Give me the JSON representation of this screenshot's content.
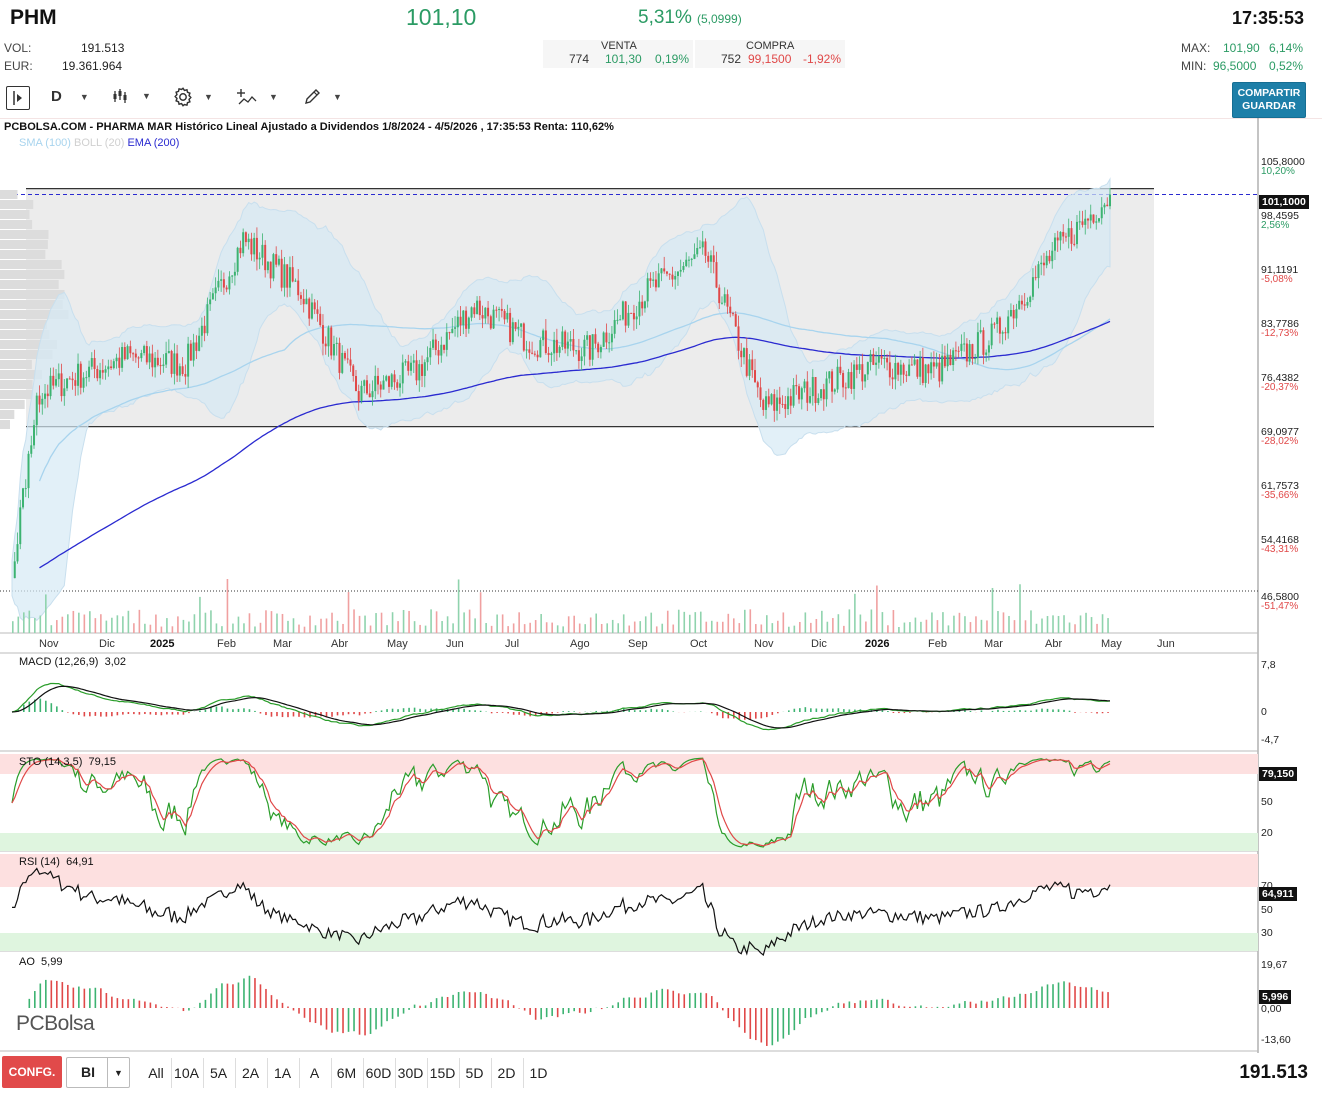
{
  "header": {
    "ticker": "PHM",
    "price": "101,10",
    "change_pct": "5,31%",
    "change_abs": "(5,0999)",
    "time": "17:35:53"
  },
  "stats": {
    "vol_label": "VOL:",
    "vol_value": "191.513",
    "eur_label": "EUR:",
    "eur_value": "19.361.964",
    "max_label": "MAX:",
    "max_value": "101,90",
    "max_pct": "6,14%",
    "min_label": "MIN:",
    "min_value": "96,5000",
    "min_pct": "0,52%"
  },
  "orderbook": {
    "sell_label": "VENTA",
    "sell_qty": "774",
    "sell_price": "101,30",
    "sell_pct": "0,19%",
    "buy_label": "COMPRA",
    "buy_qty": "752",
    "buy_price": "99,1500",
    "buy_pct": "-1,92%"
  },
  "toolbar": {
    "period": "D",
    "share_line1": "COMPARTIR",
    "share_line2": "GUARDAR",
    "icons": [
      "panel-toggle-icon",
      "candles-icon",
      "gear-icon",
      "indicator-icon",
      "pencil-icon"
    ]
  },
  "chart": {
    "title": "PCBOLSA.COM - PHARMA MAR Histórico Lineal Ajustado a Dividendos 1/8/2024 - 4/5/2026 , 17:35:53 Renta: 110,62%",
    "legend": [
      "SMA (100)",
      "BOLL (20)",
      "EMA (200)"
    ],
    "colors": {
      "sma": "#a8d4ee",
      "boll": "#c8dfee",
      "ema": "#2a2ad0",
      "up": "#3cb371",
      "down": "#e04848"
    },
    "price_axis": [
      {
        "v": "105,8000",
        "p": "10,20%",
        "c": "green"
      },
      {
        "v": "98,4595",
        "p": "2,56%",
        "c": "green"
      },
      {
        "v": "91,1191",
        "p": "-5,08%",
        "c": "red"
      },
      {
        "v": "83,7786",
        "p": "-12,73%",
        "c": "red"
      },
      {
        "v": "76,4382",
        "p": "-20,37%",
        "c": "red"
      },
      {
        "v": "69,0977",
        "p": "-28,02%",
        "c": "red"
      },
      {
        "v": "61,7573",
        "p": "-35,66%",
        "c": "red"
      },
      {
        "v": "54,4168",
        "p": "-43,31%",
        "c": "red"
      },
      {
        "v": "46,5800",
        "p": "-51,47%",
        "c": "red"
      }
    ],
    "last_price_badge": "101,1000",
    "months": [
      "Nov",
      "Dic",
      "2025",
      "Feb",
      "Mar",
      "Abr",
      "May",
      "Jun",
      "Jul",
      "Ago",
      "Sep",
      "Oct",
      "Nov",
      "Dic",
      "2026",
      "Feb",
      "Mar",
      "Abr",
      "May",
      "Jun"
    ],
    "branding": "PCBolsa"
  },
  "chart_data": {
    "type": "candlestick",
    "x_range": [
      "1/8/2024",
      "4/5/2026"
    ],
    "ylim": [
      46.58,
      105.8
    ],
    "last": 101.1,
    "channel": {
      "top": 101.9,
      "bottom": 69.5
    },
    "trend_points": [
      {
        "x": "Oct 2024",
        "y": 72
      },
      {
        "x": "Nov 2024",
        "y": 76
      },
      {
        "x": "Dic 2024",
        "y": 79
      },
      {
        "x": "Ene 2025",
        "y": 78
      },
      {
        "x": "Feb 2025",
        "y": 95
      },
      {
        "x": "Mar 2025",
        "y": 88
      },
      {
        "x": "Abr 2025",
        "y": 74
      },
      {
        "x": "May 2025",
        "y": 77
      },
      {
        "x": "Jun 2025",
        "y": 86
      },
      {
        "x": "Jul 2025",
        "y": 81
      },
      {
        "x": "Ago 2025",
        "y": 80
      },
      {
        "x": "Sep 2025",
        "y": 88
      },
      {
        "x": "Oct 2025",
        "y": 93
      },
      {
        "x": "Nov 2025",
        "y": 72
      },
      {
        "x": "Dic 2025",
        "y": 75
      },
      {
        "x": "Ene 2026",
        "y": 78
      },
      {
        "x": "Feb 2026",
        "y": 77
      },
      {
        "x": "Mar 2026",
        "y": 82
      },
      {
        "x": "Abr 2026",
        "y": 93
      },
      {
        "x": "May 2026",
        "y": 101.1
      }
    ]
  },
  "indicators": {
    "macd": {
      "title": "MACD (12,26,9)",
      "value": "3,02",
      "axis": [
        "7,8",
        "0",
        "-4,7"
      ]
    },
    "sto": {
      "title": "STO (14,3,5)",
      "value": "79,15",
      "axis": [
        "50",
        "20"
      ],
      "badge": "79,150"
    },
    "rsi": {
      "title": "RSI (14)",
      "value": "64,91",
      "axis": [
        "70",
        "50",
        "30"
      ],
      "badge": "64,911"
    },
    "ao": {
      "title": "AO",
      "value": "5,99",
      "axis": [
        "19,67",
        "0,00",
        "-13,60"
      ],
      "badge": "5,996"
    }
  },
  "bottom_bar": {
    "config": "CONFG.",
    "select_value": "BI",
    "ranges": [
      "All",
      "10A",
      "5A",
      "2A",
      "1A",
      "A",
      "6M",
      "60D",
      "30D",
      "15D",
      "5D",
      "2D",
      "1D"
    ],
    "volume": "191.513"
  }
}
